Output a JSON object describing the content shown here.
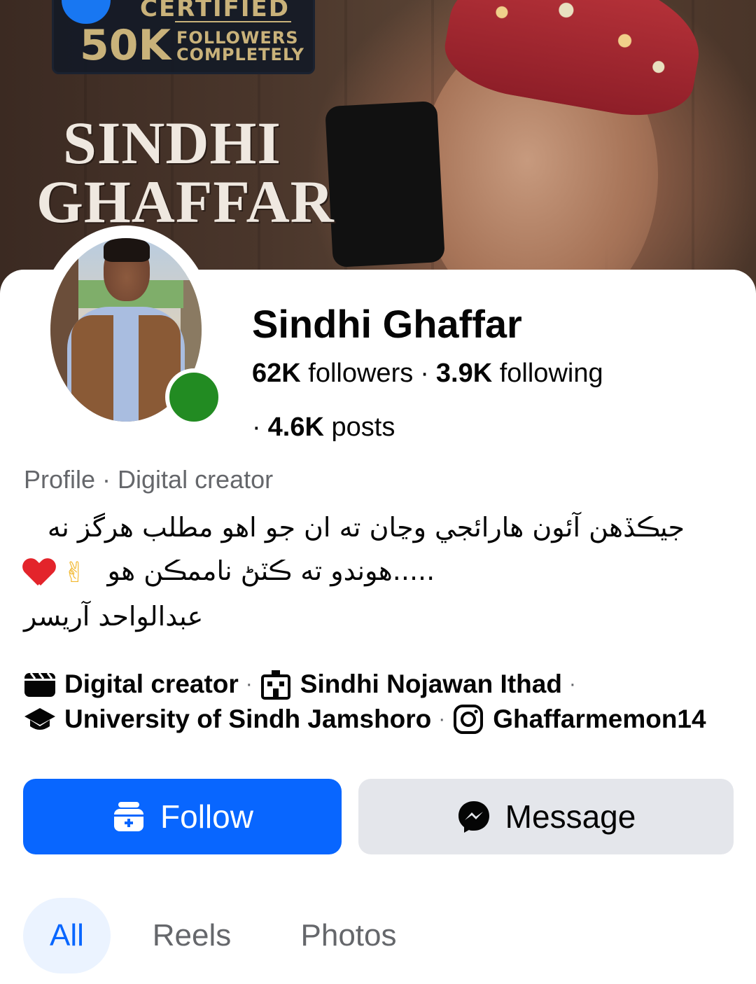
{
  "cover": {
    "badge_top": "CERTIFIED",
    "badge_number": "50K",
    "badge_line1": "FOLLOWERS",
    "badge_line2": "COMPLETELY",
    "title_line1": "SINDHI",
    "title_line2": "GHAFFAR"
  },
  "profile": {
    "name": "Sindhi Ghaffar",
    "followers_count": "62K",
    "followers_label": "followers",
    "following_count": "3.9K",
    "following_label": "following",
    "posts_count": "4.6K",
    "posts_label": "posts",
    "category": "Profile · Digital creator",
    "online": true,
    "online_color": "#228b22"
  },
  "bio": {
    "line1": "جيڪڏهن آئون هارائجي وڃان ته ان جو اهو مطلب هرگز نه",
    "line2": "هوندو ته ڪٽڻ ناممڪن هو.....",
    "line3": "عبدالواحد آريسر"
  },
  "details": [
    {
      "icon": "video-clapper-icon",
      "label": "Digital creator"
    },
    {
      "icon": "building-icon",
      "label": "Sindhi Nojawan Ithad"
    },
    {
      "icon": "graduation-cap-icon",
      "label": "University of Sindh Jamshoro"
    },
    {
      "icon": "instagram-icon",
      "label": "Ghaffarmemon14"
    }
  ],
  "actions": {
    "follow_label": "Follow",
    "message_label": "Message",
    "follow_color": "#0866ff",
    "message_bg": "#e4e6eb"
  },
  "tabs": [
    {
      "label": "All",
      "active": true
    },
    {
      "label": "Reels",
      "active": false
    },
    {
      "label": "Photos",
      "active": false
    }
  ]
}
